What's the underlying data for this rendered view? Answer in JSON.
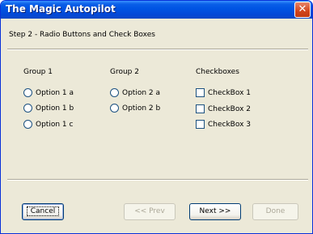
{
  "window": {
    "title": "The Magic Autopilot",
    "close_icon": "close-icon"
  },
  "step": {
    "text": "Step 2 - Radio Buttons and Check Boxes"
  },
  "group1": {
    "label": "Group 1",
    "options": [
      {
        "label": "Option 1 a",
        "checked": false
      },
      {
        "label": "Option 1 b",
        "checked": false
      },
      {
        "label": "Option 1 c",
        "checked": false
      }
    ]
  },
  "group2": {
    "label": "Group 2",
    "options": [
      {
        "label": "Option 2 a",
        "checked": false
      },
      {
        "label": "Option 2 b",
        "checked": false
      }
    ]
  },
  "checkboxes": {
    "label": "Checkboxes",
    "items": [
      {
        "label": "CheckBox 1",
        "checked": false
      },
      {
        "label": "CheckBox 2",
        "checked": false
      },
      {
        "label": "CheckBox 3",
        "checked": false
      }
    ]
  },
  "buttons": {
    "cancel": "Cancel",
    "prev": "<< Prev",
    "next": "Next >>",
    "done": "Done"
  },
  "colors": {
    "titlebar": "#0054e3",
    "face": "#ece9d8",
    "close": "#d2451c"
  }
}
